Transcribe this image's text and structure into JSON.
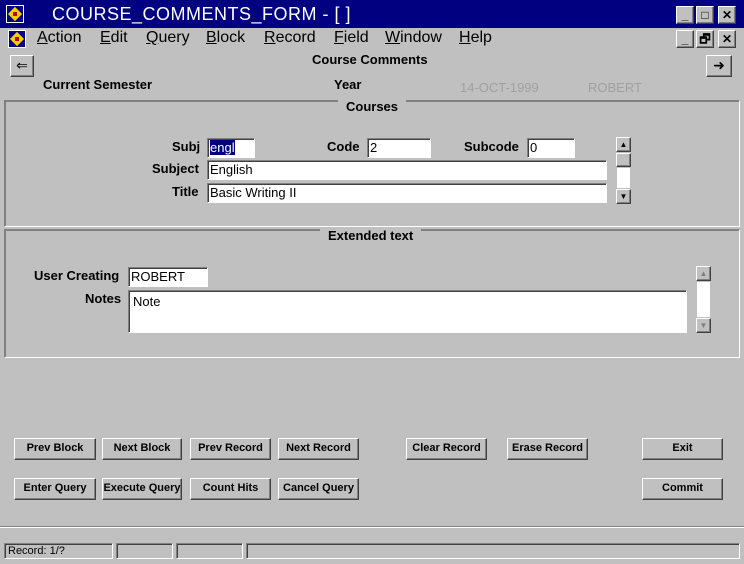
{
  "window": {
    "title": "COURSE_COMMENTS_FORM - [ ]",
    "minimize": "_",
    "maximize": "□",
    "close": "✕",
    "restore": "🗗"
  },
  "menu": {
    "items": [
      {
        "first": "A",
        "rest": "ction"
      },
      {
        "first": "E",
        "rest": "dit"
      },
      {
        "first": "Q",
        "rest": "uery"
      },
      {
        "first": "B",
        "rest": "lock"
      },
      {
        "first": "R",
        "rest": "ecord"
      },
      {
        "first": "F",
        "rest": "ield"
      },
      {
        "first": "W",
        "rest": "indow"
      },
      {
        "first": "H",
        "rest": "elp"
      }
    ]
  },
  "header": {
    "form_title": "Course Comments",
    "current_semester_label": "Current Semester",
    "year_label": "Year",
    "date": "14-OCT-1999",
    "user": "ROBERT",
    "back_arrow": "⇐",
    "forward_arrow": "➜"
  },
  "courses": {
    "frame_title": "Courses",
    "subj_label": "Subj",
    "subj_value": "engl",
    "code_label": "Code",
    "code_value": "2",
    "subcode_label": "Subcode",
    "subcode_value": "0",
    "subject_label": "Subject",
    "subject_value": "English",
    "title_label": "Title",
    "title_value": "Basic Writing II"
  },
  "extended": {
    "frame_title": "Extended text",
    "user_creating_label": "User Creating",
    "user_creating_value": "ROBERT",
    "notes_label": "Notes",
    "notes_value": "Note"
  },
  "buttons": {
    "prev_block": "Prev Block",
    "next_block": "Next Block",
    "prev_record": "Prev Record",
    "next_record": "Next Record",
    "clear_record": "Clear Record",
    "erase_record": "Erase Record",
    "exit": "Exit",
    "enter_query": "Enter Query",
    "execute_query": "Execute Query",
    "count_hits": "Count Hits",
    "cancel_query": "Cancel Query",
    "commit": "Commit"
  },
  "status": {
    "record": "Record: 1/?"
  }
}
